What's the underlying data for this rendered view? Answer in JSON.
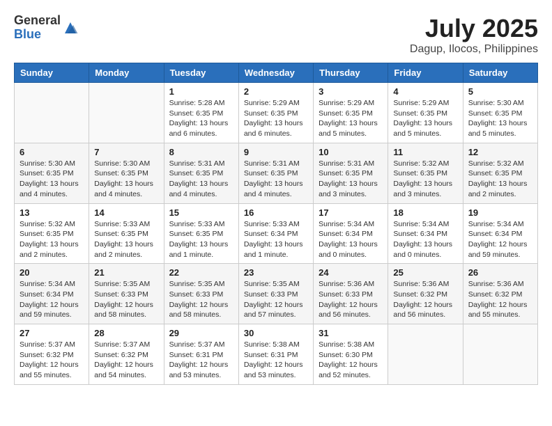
{
  "header": {
    "logo_general": "General",
    "logo_blue": "Blue",
    "month_title": "July 2025",
    "location": "Dagup, Ilocos, Philippines"
  },
  "weekdays": [
    "Sunday",
    "Monday",
    "Tuesday",
    "Wednesday",
    "Thursday",
    "Friday",
    "Saturday"
  ],
  "weeks": [
    [
      {
        "day": "",
        "sunrise": "",
        "sunset": "",
        "daylight": ""
      },
      {
        "day": "",
        "sunrise": "",
        "sunset": "",
        "daylight": ""
      },
      {
        "day": "1",
        "sunrise": "Sunrise: 5:28 AM",
        "sunset": "Sunset: 6:35 PM",
        "daylight": "Daylight: 13 hours and 6 minutes."
      },
      {
        "day": "2",
        "sunrise": "Sunrise: 5:29 AM",
        "sunset": "Sunset: 6:35 PM",
        "daylight": "Daylight: 13 hours and 6 minutes."
      },
      {
        "day": "3",
        "sunrise": "Sunrise: 5:29 AM",
        "sunset": "Sunset: 6:35 PM",
        "daylight": "Daylight: 13 hours and 5 minutes."
      },
      {
        "day": "4",
        "sunrise": "Sunrise: 5:29 AM",
        "sunset": "Sunset: 6:35 PM",
        "daylight": "Daylight: 13 hours and 5 minutes."
      },
      {
        "day": "5",
        "sunrise": "Sunrise: 5:30 AM",
        "sunset": "Sunset: 6:35 PM",
        "daylight": "Daylight: 13 hours and 5 minutes."
      }
    ],
    [
      {
        "day": "6",
        "sunrise": "Sunrise: 5:30 AM",
        "sunset": "Sunset: 6:35 PM",
        "daylight": "Daylight: 13 hours and 4 minutes."
      },
      {
        "day": "7",
        "sunrise": "Sunrise: 5:30 AM",
        "sunset": "Sunset: 6:35 PM",
        "daylight": "Daylight: 13 hours and 4 minutes."
      },
      {
        "day": "8",
        "sunrise": "Sunrise: 5:31 AM",
        "sunset": "Sunset: 6:35 PM",
        "daylight": "Daylight: 13 hours and 4 minutes."
      },
      {
        "day": "9",
        "sunrise": "Sunrise: 5:31 AM",
        "sunset": "Sunset: 6:35 PM",
        "daylight": "Daylight: 13 hours and 4 minutes."
      },
      {
        "day": "10",
        "sunrise": "Sunrise: 5:31 AM",
        "sunset": "Sunset: 6:35 PM",
        "daylight": "Daylight: 13 hours and 3 minutes."
      },
      {
        "day": "11",
        "sunrise": "Sunrise: 5:32 AM",
        "sunset": "Sunset: 6:35 PM",
        "daylight": "Daylight: 13 hours and 3 minutes."
      },
      {
        "day": "12",
        "sunrise": "Sunrise: 5:32 AM",
        "sunset": "Sunset: 6:35 PM",
        "daylight": "Daylight: 13 hours and 2 minutes."
      }
    ],
    [
      {
        "day": "13",
        "sunrise": "Sunrise: 5:32 AM",
        "sunset": "Sunset: 6:35 PM",
        "daylight": "Daylight: 13 hours and 2 minutes."
      },
      {
        "day": "14",
        "sunrise": "Sunrise: 5:33 AM",
        "sunset": "Sunset: 6:35 PM",
        "daylight": "Daylight: 13 hours and 2 minutes."
      },
      {
        "day": "15",
        "sunrise": "Sunrise: 5:33 AM",
        "sunset": "Sunset: 6:35 PM",
        "daylight": "Daylight: 13 hours and 1 minute."
      },
      {
        "day": "16",
        "sunrise": "Sunrise: 5:33 AM",
        "sunset": "Sunset: 6:34 PM",
        "daylight": "Daylight: 13 hours and 1 minute."
      },
      {
        "day": "17",
        "sunrise": "Sunrise: 5:34 AM",
        "sunset": "Sunset: 6:34 PM",
        "daylight": "Daylight: 13 hours and 0 minutes."
      },
      {
        "day": "18",
        "sunrise": "Sunrise: 5:34 AM",
        "sunset": "Sunset: 6:34 PM",
        "daylight": "Daylight: 13 hours and 0 minutes."
      },
      {
        "day": "19",
        "sunrise": "Sunrise: 5:34 AM",
        "sunset": "Sunset: 6:34 PM",
        "daylight": "Daylight: 12 hours and 59 minutes."
      }
    ],
    [
      {
        "day": "20",
        "sunrise": "Sunrise: 5:34 AM",
        "sunset": "Sunset: 6:34 PM",
        "daylight": "Daylight: 12 hours and 59 minutes."
      },
      {
        "day": "21",
        "sunrise": "Sunrise: 5:35 AM",
        "sunset": "Sunset: 6:33 PM",
        "daylight": "Daylight: 12 hours and 58 minutes."
      },
      {
        "day": "22",
        "sunrise": "Sunrise: 5:35 AM",
        "sunset": "Sunset: 6:33 PM",
        "daylight": "Daylight: 12 hours and 58 minutes."
      },
      {
        "day": "23",
        "sunrise": "Sunrise: 5:35 AM",
        "sunset": "Sunset: 6:33 PM",
        "daylight": "Daylight: 12 hours and 57 minutes."
      },
      {
        "day": "24",
        "sunrise": "Sunrise: 5:36 AM",
        "sunset": "Sunset: 6:33 PM",
        "daylight": "Daylight: 12 hours and 56 minutes."
      },
      {
        "day": "25",
        "sunrise": "Sunrise: 5:36 AM",
        "sunset": "Sunset: 6:32 PM",
        "daylight": "Daylight: 12 hours and 56 minutes."
      },
      {
        "day": "26",
        "sunrise": "Sunrise: 5:36 AM",
        "sunset": "Sunset: 6:32 PM",
        "daylight": "Daylight: 12 hours and 55 minutes."
      }
    ],
    [
      {
        "day": "27",
        "sunrise": "Sunrise: 5:37 AM",
        "sunset": "Sunset: 6:32 PM",
        "daylight": "Daylight: 12 hours and 55 minutes."
      },
      {
        "day": "28",
        "sunrise": "Sunrise: 5:37 AM",
        "sunset": "Sunset: 6:32 PM",
        "daylight": "Daylight: 12 hours and 54 minutes."
      },
      {
        "day": "29",
        "sunrise": "Sunrise: 5:37 AM",
        "sunset": "Sunset: 6:31 PM",
        "daylight": "Daylight: 12 hours and 53 minutes."
      },
      {
        "day": "30",
        "sunrise": "Sunrise: 5:38 AM",
        "sunset": "Sunset: 6:31 PM",
        "daylight": "Daylight: 12 hours and 53 minutes."
      },
      {
        "day": "31",
        "sunrise": "Sunrise: 5:38 AM",
        "sunset": "Sunset: 6:30 PM",
        "daylight": "Daylight: 12 hours and 52 minutes."
      },
      {
        "day": "",
        "sunrise": "",
        "sunset": "",
        "daylight": ""
      },
      {
        "day": "",
        "sunrise": "",
        "sunset": "",
        "daylight": ""
      }
    ]
  ]
}
